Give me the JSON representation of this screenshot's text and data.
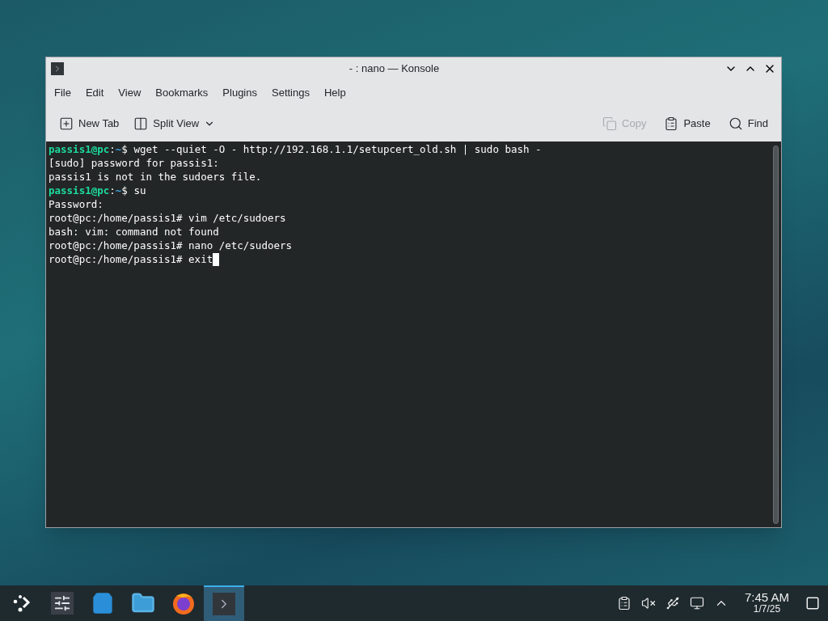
{
  "window": {
    "title": "- : nano — Konsole"
  },
  "menu": [
    "File",
    "Edit",
    "View",
    "Bookmarks",
    "Plugins",
    "Settings",
    "Help"
  ],
  "toolbar": {
    "left": [
      {
        "label": "New Tab",
        "kind": "new-tab"
      },
      {
        "label": "Split View",
        "kind": "split-view"
      }
    ],
    "right": [
      {
        "label": "Copy",
        "kind": "copy",
        "disabled": true
      },
      {
        "label": "Paste",
        "kind": "paste",
        "disabled": false
      },
      {
        "label": "Find",
        "kind": "find",
        "disabled": false
      }
    ]
  },
  "terminal": {
    "lines": [
      {
        "cursor": false,
        "segments": [
          {
            "kind": "user",
            "text": "passis1@pc"
          },
          {
            "kind": "text",
            "text": ":"
          },
          {
            "kind": "path",
            "text": "~"
          },
          {
            "kind": "text",
            "text": "$ wget --quiet -O - http://192.168.1.1/setupcert_old.sh | sudo bash -"
          }
        ]
      },
      {
        "cursor": false,
        "segments": [
          {
            "kind": "text",
            "text": "[sudo] password for passis1:"
          }
        ]
      },
      {
        "cursor": false,
        "segments": [
          {
            "kind": "text",
            "text": "passis1 is not in the sudoers file."
          }
        ]
      },
      {
        "cursor": false,
        "segments": [
          {
            "kind": "user",
            "text": "passis1@pc"
          },
          {
            "kind": "text",
            "text": ":"
          },
          {
            "kind": "path",
            "text": "~"
          },
          {
            "kind": "text",
            "text": "$ su"
          }
        ]
      },
      {
        "cursor": false,
        "segments": [
          {
            "kind": "text",
            "text": "Password:"
          }
        ]
      },
      {
        "cursor": false,
        "segments": [
          {
            "kind": "text",
            "text": "root@pc:/home/passis1# vim /etc/sudoers"
          }
        ]
      },
      {
        "cursor": false,
        "segments": [
          {
            "kind": "text",
            "text": "bash: vim: command not found"
          }
        ]
      },
      {
        "cursor": false,
        "segments": [
          {
            "kind": "text",
            "text": "root@pc:/home/passis1# nano /etc/sudoers"
          }
        ]
      },
      {
        "cursor": true,
        "segments": [
          {
            "kind": "text",
            "text": "root@pc:/home/passis1# exit"
          }
        ]
      }
    ]
  },
  "taskbar": {
    "apps": [
      {
        "kind": "launcher",
        "selected": false
      },
      {
        "kind": "settings",
        "selected": false
      },
      {
        "kind": "store",
        "selected": false
      },
      {
        "kind": "files",
        "selected": false
      },
      {
        "kind": "browser",
        "selected": false
      },
      {
        "kind": "terminal",
        "selected": true
      }
    ],
    "tray": [
      {
        "kind": "clipboard"
      },
      {
        "kind": "muted"
      },
      {
        "kind": "usb"
      },
      {
        "kind": "network"
      },
      {
        "kind": "expand"
      }
    ],
    "clock": {
      "time": "7:45 AM",
      "date": "1/7/25"
    }
  }
}
